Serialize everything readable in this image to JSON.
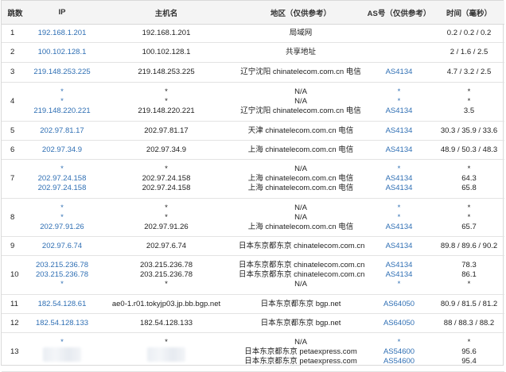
{
  "headers": {
    "hop": "跳数",
    "ip": "IP",
    "host": "主机名",
    "region": "地区（仅供参考）",
    "asn": "AS号（仅供参考）",
    "time": "时间（毫秒）"
  },
  "rows": [
    {
      "hop": "1",
      "ip": [
        "192.168.1.201"
      ],
      "host": [
        "192.168.1.201"
      ],
      "region": [
        "局域网"
      ],
      "asn": [
        ""
      ],
      "time": [
        "0.2 / 0.2 / 0.2"
      ]
    },
    {
      "hop": "2",
      "ip": [
        "100.102.128.1"
      ],
      "host": [
        "100.102.128.1"
      ],
      "region": [
        "共享地址"
      ],
      "asn": [
        ""
      ],
      "time": [
        "2 / 1.6 / 2.5"
      ]
    },
    {
      "hop": "3",
      "ip": [
        "219.148.253.225"
      ],
      "host": [
        "219.148.253.225"
      ],
      "region": [
        "辽宁沈阳 chinatelecom.com.cn 电信"
      ],
      "asn": [
        "AS4134"
      ],
      "time": [
        "4.7 / 3.2 / 2.5"
      ]
    },
    {
      "hop": "4",
      "ip": [
        "*",
        "*",
        "219.148.220.221"
      ],
      "host": [
        "*",
        "*",
        "219.148.220.221"
      ],
      "region": [
        "N/A",
        "N/A",
        "辽宁沈阳 chinatelecom.com.cn 电信"
      ],
      "asn": [
        "*",
        "*",
        "AS4134"
      ],
      "time": [
        "*",
        "*",
        "3.5"
      ]
    },
    {
      "hop": "5",
      "ip": [
        "202.97.81.17"
      ],
      "host": [
        "202.97.81.17"
      ],
      "region": [
        "天津 chinatelecom.com.cn 电信"
      ],
      "asn": [
        "AS4134"
      ],
      "time": [
        "30.3 / 35.9 / 33.6"
      ]
    },
    {
      "hop": "6",
      "ip": [
        "202.97.34.9"
      ],
      "host": [
        "202.97.34.9"
      ],
      "region": [
        "上海 chinatelecom.com.cn 电信"
      ],
      "asn": [
        "AS4134"
      ],
      "time": [
        "48.9 / 50.3 / 48.3"
      ]
    },
    {
      "hop": "7",
      "ip": [
        "*",
        "202.97.24.158",
        "202.97.24.158"
      ],
      "host": [
        "*",
        "202.97.24.158",
        "202.97.24.158"
      ],
      "region": [
        "N/A",
        "上海 chinatelecom.com.cn 电信",
        "上海 chinatelecom.com.cn 电信"
      ],
      "asn": [
        "*",
        "AS4134",
        "AS4134"
      ],
      "time": [
        "*",
        "64.3",
        "65.8"
      ]
    },
    {
      "hop": "8",
      "ip": [
        "*",
        "*",
        "202.97.91.26"
      ],
      "host": [
        "*",
        "*",
        "202.97.91.26"
      ],
      "region": [
        "N/A",
        "N/A",
        "上海 chinatelecom.com.cn 电信"
      ],
      "asn": [
        "*",
        "*",
        "AS4134"
      ],
      "time": [
        "*",
        "*",
        "65.7"
      ]
    },
    {
      "hop": "9",
      "ip": [
        "202.97.6.74"
      ],
      "host": [
        "202.97.6.74"
      ],
      "region": [
        "日本东京都东京 chinatelecom.com.cn 电信"
      ],
      "asn": [
        "AS4134"
      ],
      "time": [
        "89.8 / 89.6 / 90.2"
      ]
    },
    {
      "hop": "10",
      "ip": [
        "203.215.236.78",
        "203.215.236.78",
        "*"
      ],
      "host": [
        "203.215.236.78",
        "203.215.236.78",
        "*"
      ],
      "region": [
        "日本东京都东京 chinatelecom.com.cn 电信",
        "日本东京都东京 chinatelecom.com.cn 电信",
        "N/A"
      ],
      "asn": [
        "AS4134",
        "AS4134",
        "*"
      ],
      "time": [
        "78.3",
        "86.1",
        "*"
      ]
    },
    {
      "hop": "11",
      "ip": [
        "182.54.128.61"
      ],
      "host": [
        "ae0-1.r01.tokyjp03.jp.bb.bgp.net"
      ],
      "region": [
        "日本东京都东京 bgp.net"
      ],
      "asn": [
        "AS64050"
      ],
      "time": [
        "80.9 / 81.5 / 81.2"
      ]
    },
    {
      "hop": "12",
      "ip": [
        "182.54.128.133"
      ],
      "host": [
        "182.54.128.133"
      ],
      "region": [
        "日本东京都东京 bgp.net"
      ],
      "asn": [
        "AS64050"
      ],
      "time": [
        "88 / 88.3 / 88.2"
      ]
    },
    {
      "hop": "13",
      "ip": [
        "*",
        "",
        ""
      ],
      "host": [
        "*",
        "",
        ""
      ],
      "region": [
        "N/A",
        "日本东京都东京 petaexpress.com",
        "日本东京都东京 petaexpress.com"
      ],
      "asn": [
        "*",
        "AS54600",
        "AS54600"
      ],
      "time": [
        "*",
        "95.6",
        "95.4"
      ]
    }
  ]
}
